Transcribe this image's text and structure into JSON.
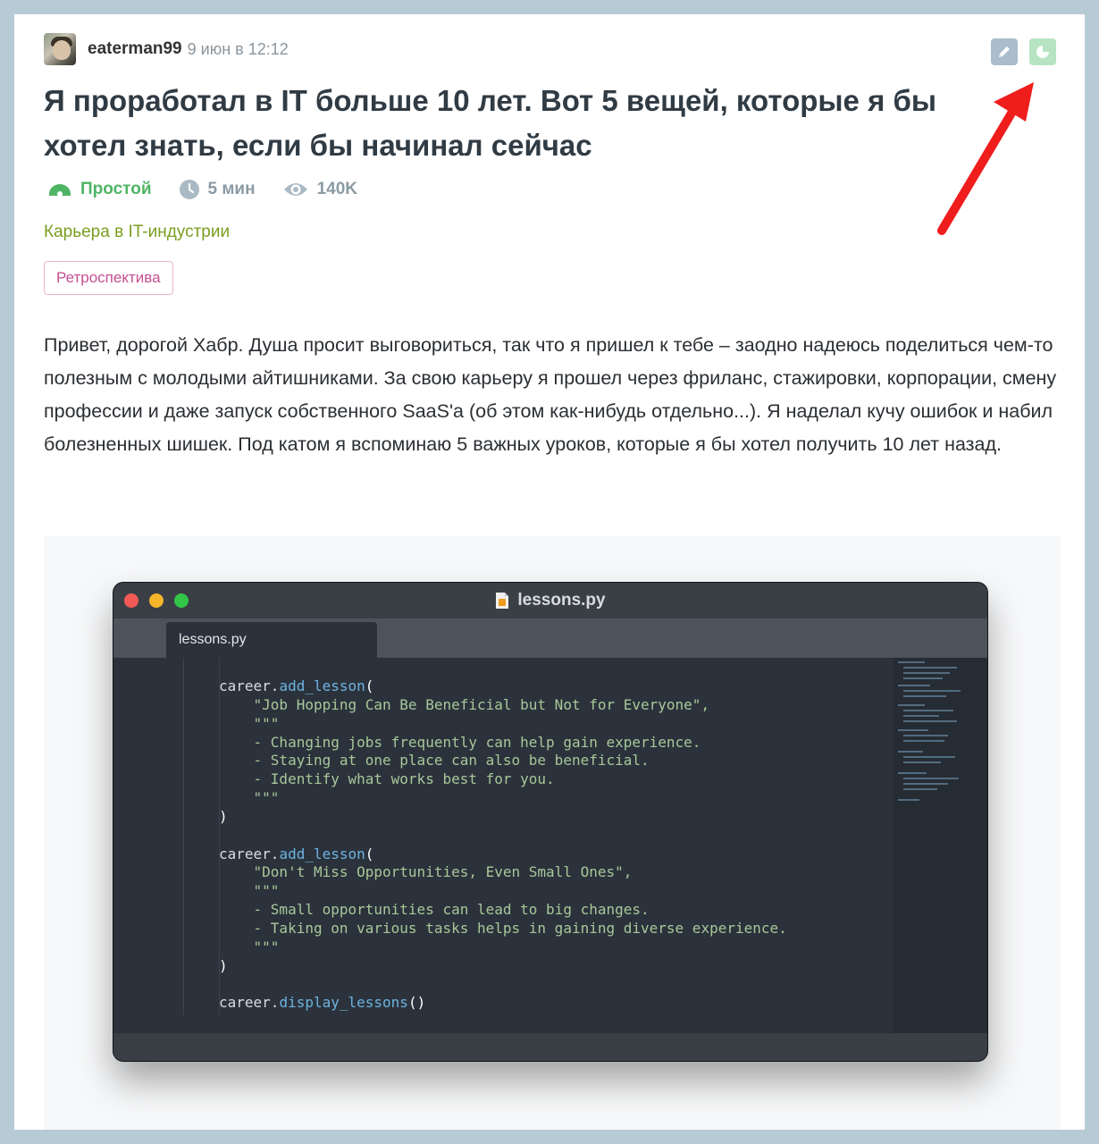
{
  "post": {
    "author": "eaterman99",
    "date": "9 июн в 12:12",
    "title": "Я проработал в IT больше 10 лет. Вот 5 вещей, которые я бы хотел знать, если бы начинал сейчас",
    "meta": {
      "level": "Простой",
      "reading_time": "5 мин",
      "views": "140K"
    },
    "hub": "Карьера в IT-индустрии",
    "tag": "Ретроспектива",
    "body": "Привет, дорогой Хабр. Душа просит выговориться, так что я пришел к тебе – заодно надеюсь поделиться чем-то полезным с молодыми айтишниками. За свою карьеру я прошел через фриланс, стажировки, корпорации, смену профессии и даже запуск собственного SaaS'a (об этом как-нибудь отдельно...). Я наделал кучу ошибок и набил болезненных шишек. Под катом я вспоминаю 5 важных уроков, которые я бы хотел получить 10 лет назад."
  },
  "top_icons": [
    "pencil-icon",
    "pie-chart-icon"
  ],
  "colors": {
    "level": "#4eb565",
    "hub": "#7b9e20",
    "tag": "#c64f92",
    "arrow": "#f01d1d"
  },
  "code_window": {
    "window_title": "lessons.py",
    "tab_label": "lessons.py",
    "code": {
      "l1_obj": "career.",
      "l1_fn": "add_lesson",
      "l1_paren": "(",
      "l2": "    \"Job Hopping Can Be Beneficial but Not for Everyone\",",
      "l3": "    \"\"\"",
      "l4": "    - Changing jobs frequently can help gain experience.",
      "l5": "    - Staying at one place can also be beneficial.",
      "l6": "    - Identify what works best for you.",
      "l7": "    \"\"\"",
      "l8": ")",
      "l10_obj": "career.",
      "l10_fn": "add_lesson",
      "l10_paren": "(",
      "l11": "    \"Don't Miss Opportunities, Even Small Ones\",",
      "l12": "    \"\"\"",
      "l13": "    - Small opportunities can lead to big changes.",
      "l14": "    - Taking on various tasks helps in gaining diverse experience.",
      "l15": "    \"\"\"",
      "l16": ")",
      "l18_obj": "career.",
      "l18_fn": "display_lessons",
      "l18_paren": "()"
    }
  }
}
